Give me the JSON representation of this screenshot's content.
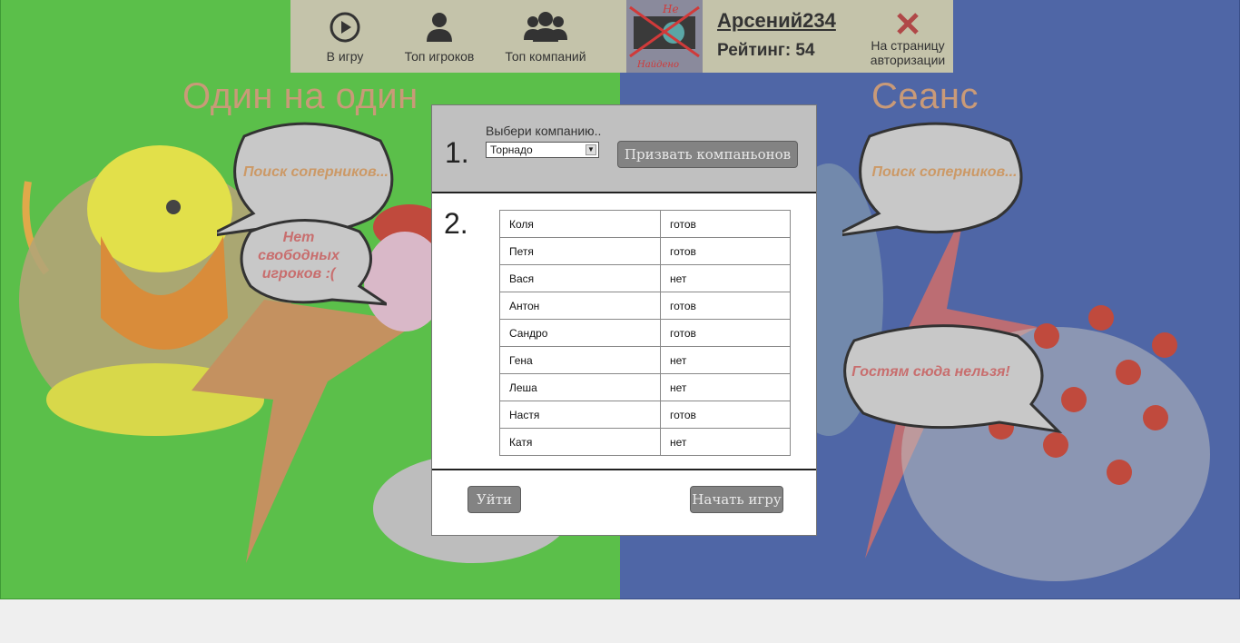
{
  "nav": {
    "play": {
      "label": "В игру",
      "icon": "play-circle-icon"
    },
    "top_players": {
      "label": "Топ игроков",
      "icon": "user-icon"
    },
    "top_companies": {
      "label": "Топ компаний",
      "icon": "users-group-icon"
    }
  },
  "user": {
    "name": "Арсений234",
    "rating": "Рейтинг: 54",
    "avatar_text_top": "Не",
    "avatar_text_bottom": "Найдено"
  },
  "logout": {
    "label": "На страницу авторизации",
    "icon": "close-x-icon"
  },
  "modes": {
    "left_title": "Один на один",
    "right_title": "Сеанс",
    "left_bubble1": "Поиск соперников...",
    "left_bubble2": "Нет свободных игроков :(",
    "right_bubble1": "Поиск соперников...",
    "right_bubble2": "Гостям сюда нельзя!"
  },
  "modal": {
    "step1_number": "1.",
    "step2_number": "2.",
    "choose_label": "Выбери компанию..",
    "company_selected": "Торнадо",
    "summon_button": "Призвать компаньонов",
    "leave_button": "Уйти",
    "start_button": "Начать игру",
    "players": [
      {
        "name": "Коля",
        "status": "готов"
      },
      {
        "name": "Петя",
        "status": "готов"
      },
      {
        "name": "Вася",
        "status": "нет"
      },
      {
        "name": "Антон",
        "status": "готов"
      },
      {
        "name": "Сандро",
        "status": "готов"
      },
      {
        "name": "Гена",
        "status": "нет"
      },
      {
        "name": "Леша",
        "status": "нет"
      },
      {
        "name": "Настя",
        "status": "готов"
      },
      {
        "name": "Катя",
        "status": "нет"
      }
    ]
  },
  "colors": {
    "left_bg": "#5bbf4a",
    "right_bg": "#4f66a6",
    "nav_bg": "#c4c3aa",
    "button_bg": "#838383"
  }
}
